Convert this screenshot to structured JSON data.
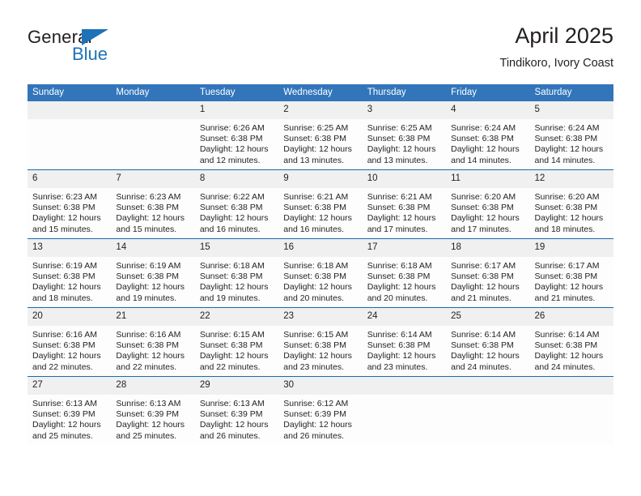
{
  "brand": {
    "name_dark": "General",
    "name_blue": "Blue",
    "triangle_color": "#1d72b8"
  },
  "header": {
    "month_title": "April 2025",
    "location": "Tindikoro, Ivory Coast"
  },
  "theme": {
    "header_bg": "#3275bb",
    "header_text": "#ffffff",
    "daynum_bg": "#f0f0f0",
    "row_divider": "#1a6aad",
    "cell_bg": "#fdfdfd",
    "text": "#231f20"
  },
  "calendar": {
    "weekday_headers": [
      "Sunday",
      "Monday",
      "Tuesday",
      "Wednesday",
      "Thursday",
      "Friday",
      "Saturday"
    ],
    "weeks": [
      [
        {
          "day": "",
          "sunrise": "",
          "sunset": "",
          "daylight_1": "",
          "daylight_2": ""
        },
        {
          "day": "",
          "sunrise": "",
          "sunset": "",
          "daylight_1": "",
          "daylight_2": ""
        },
        {
          "day": "1",
          "sunrise": "Sunrise: 6:26 AM",
          "sunset": "Sunset: 6:38 PM",
          "daylight_1": "Daylight: 12 hours",
          "daylight_2": "and 12 minutes."
        },
        {
          "day": "2",
          "sunrise": "Sunrise: 6:25 AM",
          "sunset": "Sunset: 6:38 PM",
          "daylight_1": "Daylight: 12 hours",
          "daylight_2": "and 13 minutes."
        },
        {
          "day": "3",
          "sunrise": "Sunrise: 6:25 AM",
          "sunset": "Sunset: 6:38 PM",
          "daylight_1": "Daylight: 12 hours",
          "daylight_2": "and 13 minutes."
        },
        {
          "day": "4",
          "sunrise": "Sunrise: 6:24 AM",
          "sunset": "Sunset: 6:38 PM",
          "daylight_1": "Daylight: 12 hours",
          "daylight_2": "and 14 minutes."
        },
        {
          "day": "5",
          "sunrise": "Sunrise: 6:24 AM",
          "sunset": "Sunset: 6:38 PM",
          "daylight_1": "Daylight: 12 hours",
          "daylight_2": "and 14 minutes."
        }
      ],
      [
        {
          "day": "6",
          "sunrise": "Sunrise: 6:23 AM",
          "sunset": "Sunset: 6:38 PM",
          "daylight_1": "Daylight: 12 hours",
          "daylight_2": "and 15 minutes."
        },
        {
          "day": "7",
          "sunrise": "Sunrise: 6:23 AM",
          "sunset": "Sunset: 6:38 PM",
          "daylight_1": "Daylight: 12 hours",
          "daylight_2": "and 15 minutes."
        },
        {
          "day": "8",
          "sunrise": "Sunrise: 6:22 AM",
          "sunset": "Sunset: 6:38 PM",
          "daylight_1": "Daylight: 12 hours",
          "daylight_2": "and 16 minutes."
        },
        {
          "day": "9",
          "sunrise": "Sunrise: 6:21 AM",
          "sunset": "Sunset: 6:38 PM",
          "daylight_1": "Daylight: 12 hours",
          "daylight_2": "and 16 minutes."
        },
        {
          "day": "10",
          "sunrise": "Sunrise: 6:21 AM",
          "sunset": "Sunset: 6:38 PM",
          "daylight_1": "Daylight: 12 hours",
          "daylight_2": "and 17 minutes."
        },
        {
          "day": "11",
          "sunrise": "Sunrise: 6:20 AM",
          "sunset": "Sunset: 6:38 PM",
          "daylight_1": "Daylight: 12 hours",
          "daylight_2": "and 17 minutes."
        },
        {
          "day": "12",
          "sunrise": "Sunrise: 6:20 AM",
          "sunset": "Sunset: 6:38 PM",
          "daylight_1": "Daylight: 12 hours",
          "daylight_2": "and 18 minutes."
        }
      ],
      [
        {
          "day": "13",
          "sunrise": "Sunrise: 6:19 AM",
          "sunset": "Sunset: 6:38 PM",
          "daylight_1": "Daylight: 12 hours",
          "daylight_2": "and 18 minutes."
        },
        {
          "day": "14",
          "sunrise": "Sunrise: 6:19 AM",
          "sunset": "Sunset: 6:38 PM",
          "daylight_1": "Daylight: 12 hours",
          "daylight_2": "and 19 minutes."
        },
        {
          "day": "15",
          "sunrise": "Sunrise: 6:18 AM",
          "sunset": "Sunset: 6:38 PM",
          "daylight_1": "Daylight: 12 hours",
          "daylight_2": "and 19 minutes."
        },
        {
          "day": "16",
          "sunrise": "Sunrise: 6:18 AM",
          "sunset": "Sunset: 6:38 PM",
          "daylight_1": "Daylight: 12 hours",
          "daylight_2": "and 20 minutes."
        },
        {
          "day": "17",
          "sunrise": "Sunrise: 6:18 AM",
          "sunset": "Sunset: 6:38 PM",
          "daylight_1": "Daylight: 12 hours",
          "daylight_2": "and 20 minutes."
        },
        {
          "day": "18",
          "sunrise": "Sunrise: 6:17 AM",
          "sunset": "Sunset: 6:38 PM",
          "daylight_1": "Daylight: 12 hours",
          "daylight_2": "and 21 minutes."
        },
        {
          "day": "19",
          "sunrise": "Sunrise: 6:17 AM",
          "sunset": "Sunset: 6:38 PM",
          "daylight_1": "Daylight: 12 hours",
          "daylight_2": "and 21 minutes."
        }
      ],
      [
        {
          "day": "20",
          "sunrise": "Sunrise: 6:16 AM",
          "sunset": "Sunset: 6:38 PM",
          "daylight_1": "Daylight: 12 hours",
          "daylight_2": "and 22 minutes."
        },
        {
          "day": "21",
          "sunrise": "Sunrise: 6:16 AM",
          "sunset": "Sunset: 6:38 PM",
          "daylight_1": "Daylight: 12 hours",
          "daylight_2": "and 22 minutes."
        },
        {
          "day": "22",
          "sunrise": "Sunrise: 6:15 AM",
          "sunset": "Sunset: 6:38 PM",
          "daylight_1": "Daylight: 12 hours",
          "daylight_2": "and 22 minutes."
        },
        {
          "day": "23",
          "sunrise": "Sunrise: 6:15 AM",
          "sunset": "Sunset: 6:38 PM",
          "daylight_1": "Daylight: 12 hours",
          "daylight_2": "and 23 minutes."
        },
        {
          "day": "24",
          "sunrise": "Sunrise: 6:14 AM",
          "sunset": "Sunset: 6:38 PM",
          "daylight_1": "Daylight: 12 hours",
          "daylight_2": "and 23 minutes."
        },
        {
          "day": "25",
          "sunrise": "Sunrise: 6:14 AM",
          "sunset": "Sunset: 6:38 PM",
          "daylight_1": "Daylight: 12 hours",
          "daylight_2": "and 24 minutes."
        },
        {
          "day": "26",
          "sunrise": "Sunrise: 6:14 AM",
          "sunset": "Sunset: 6:38 PM",
          "daylight_1": "Daylight: 12 hours",
          "daylight_2": "and 24 minutes."
        }
      ],
      [
        {
          "day": "27",
          "sunrise": "Sunrise: 6:13 AM",
          "sunset": "Sunset: 6:39 PM",
          "daylight_1": "Daylight: 12 hours",
          "daylight_2": "and 25 minutes."
        },
        {
          "day": "28",
          "sunrise": "Sunrise: 6:13 AM",
          "sunset": "Sunset: 6:39 PM",
          "daylight_1": "Daylight: 12 hours",
          "daylight_2": "and 25 minutes."
        },
        {
          "day": "29",
          "sunrise": "Sunrise: 6:13 AM",
          "sunset": "Sunset: 6:39 PM",
          "daylight_1": "Daylight: 12 hours",
          "daylight_2": "and 26 minutes."
        },
        {
          "day": "30",
          "sunrise": "Sunrise: 6:12 AM",
          "sunset": "Sunset: 6:39 PM",
          "daylight_1": "Daylight: 12 hours",
          "daylight_2": "and 26 minutes."
        },
        {
          "day": "",
          "sunrise": "",
          "sunset": "",
          "daylight_1": "",
          "daylight_2": ""
        },
        {
          "day": "",
          "sunrise": "",
          "sunset": "",
          "daylight_1": "",
          "daylight_2": ""
        },
        {
          "day": "",
          "sunrise": "",
          "sunset": "",
          "daylight_1": "",
          "daylight_2": ""
        }
      ]
    ]
  }
}
